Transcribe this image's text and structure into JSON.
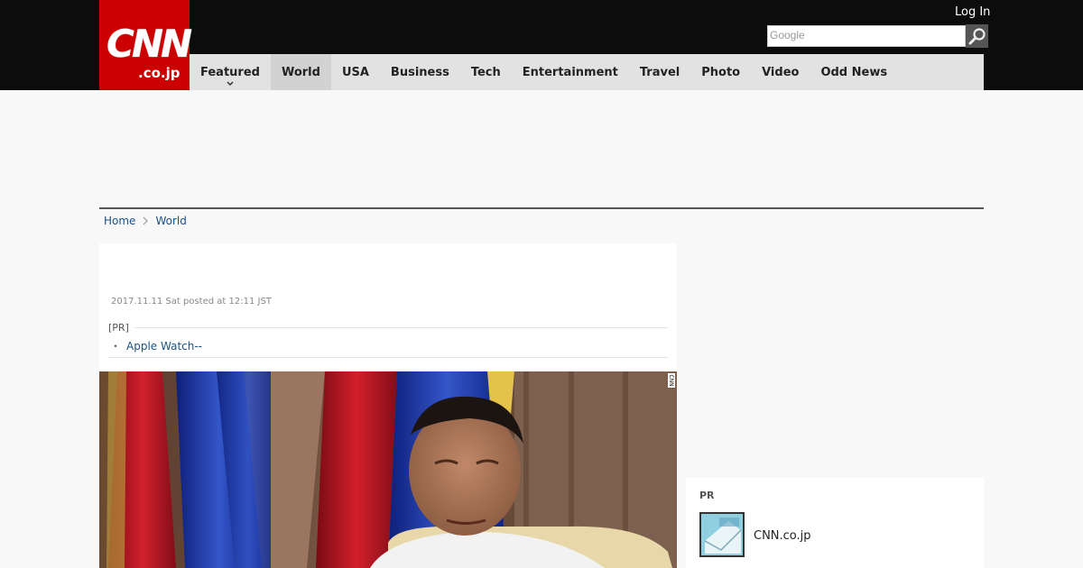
{
  "header": {
    "logo_main": "CNN",
    "logo_sub": ".co.jp",
    "login_label": "Log In",
    "search_placeholder": "Google",
    "search_icon": "magnifier-icon"
  },
  "nav": {
    "items": [
      {
        "label": "Featured"
      },
      {
        "label": "World"
      },
      {
        "label": "USA"
      },
      {
        "label": "Business"
      },
      {
        "label": "Tech"
      },
      {
        "label": "Entertainment"
      },
      {
        "label": "Travel"
      },
      {
        "label": "Photo"
      },
      {
        "label": "Video"
      },
      {
        "label": "Odd News"
      }
    ],
    "active": "World",
    "dropdown_icon": "chevron-down-icon"
  },
  "breadcrumb": {
    "home": "Home",
    "current": "World"
  },
  "article": {
    "posted": "2017.11.11 Sat posted at 12:11 JST",
    "pr_tag": "[PR]",
    "pr_bullet": "・",
    "pr_link": "Apple Watch--",
    "photo_watermark": "CNN"
  },
  "sidebar": {
    "title": "PR",
    "item_label": "CNN.co.jp",
    "item_icon": "mail-thumbnail-icon"
  },
  "colors": {
    "brand_red": "#cc0000",
    "topbar": "#0c0c0c",
    "nav_bg": "#e2e2e2",
    "link": "#1a5184"
  }
}
